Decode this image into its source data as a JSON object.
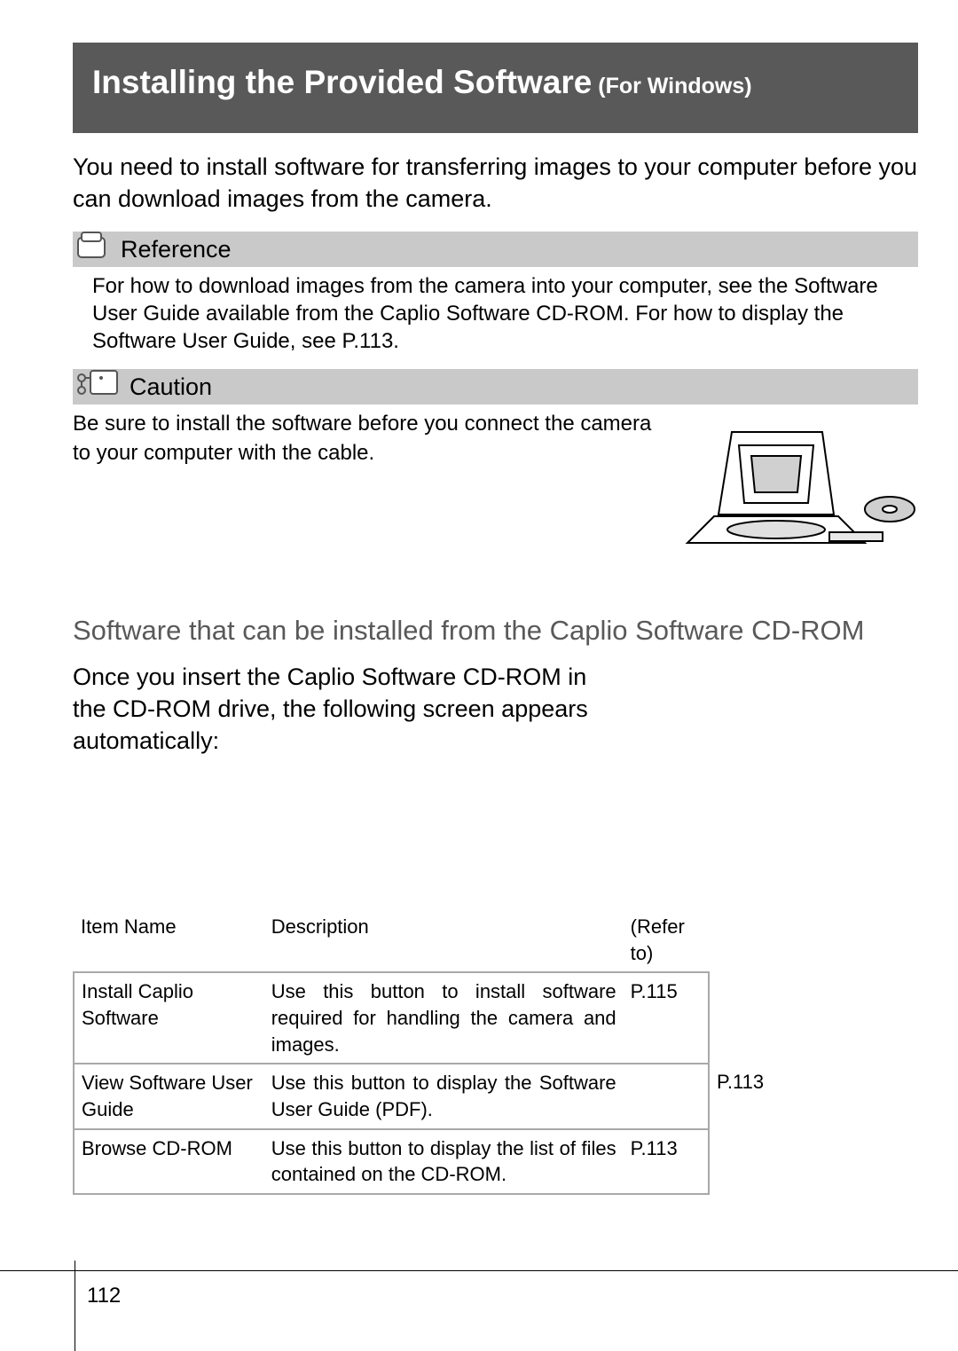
{
  "header": {
    "title_main": "Installing the Provided Software",
    "title_sub": " (For Windows)"
  },
  "intro": "You need to install software for transferring images to your computer before you can download images from the camera.",
  "reference": {
    "label": "Reference",
    "body": "For how to download images from the camera into your computer, see the Software User Guide available from the Caplio Software CD-ROM. For how to display the Software User Guide, see P.113."
  },
  "caution": {
    "label": "Caution",
    "body": "Be sure to install the software before you connect the camera to your computer with the cable."
  },
  "section": {
    "heading": "Software that can be installed from the Caplio Software CD-ROM",
    "body": "Once you insert the Caplio Software CD-ROM in the CD-ROM drive, the following screen appears automatically:"
  },
  "table": {
    "head": {
      "item": "Item Name",
      "desc": "Description",
      "ref": "(Refer to)"
    },
    "rows": [
      {
        "item": "Install Caplio Software",
        "desc": "Use this button to install software required for handling the camera and images.",
        "ref": "P.115",
        "extra": ""
      },
      {
        "item": "View Software User Guide",
        "desc": "Use this button to display the Software User Guide (PDF).",
        "ref": "",
        "extra": "P.113"
      },
      {
        "item": "Browse CD-ROM",
        "desc": "Use this button to display the list of files contained on the CD-ROM.",
        "ref": "P.113",
        "extra": ""
      }
    ]
  },
  "page_number": "112"
}
